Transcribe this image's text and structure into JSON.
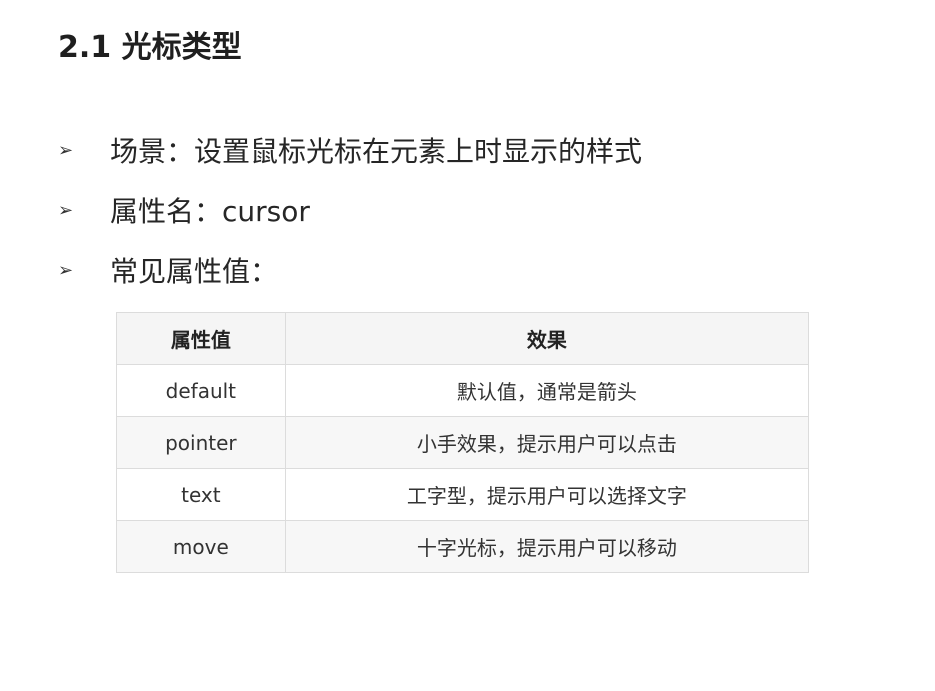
{
  "title": "2.1 光标类型",
  "bullet_icon": "arrowhead-bullet-icon",
  "bullets": [
    "场景：设置鼠标光标在元素上时显示的样式",
    "属性名：cursor",
    "常见属性值："
  ],
  "table": {
    "headers": [
      "属性值",
      "效果"
    ],
    "rows": [
      [
        "default",
        "默认值，通常是箭头"
      ],
      [
        "pointer",
        "小手效果，提示用户可以点击"
      ],
      [
        "text",
        "工字型，提示用户可以选择文字"
      ],
      [
        "move",
        "十字光标，提示用户可以移动"
      ]
    ]
  }
}
